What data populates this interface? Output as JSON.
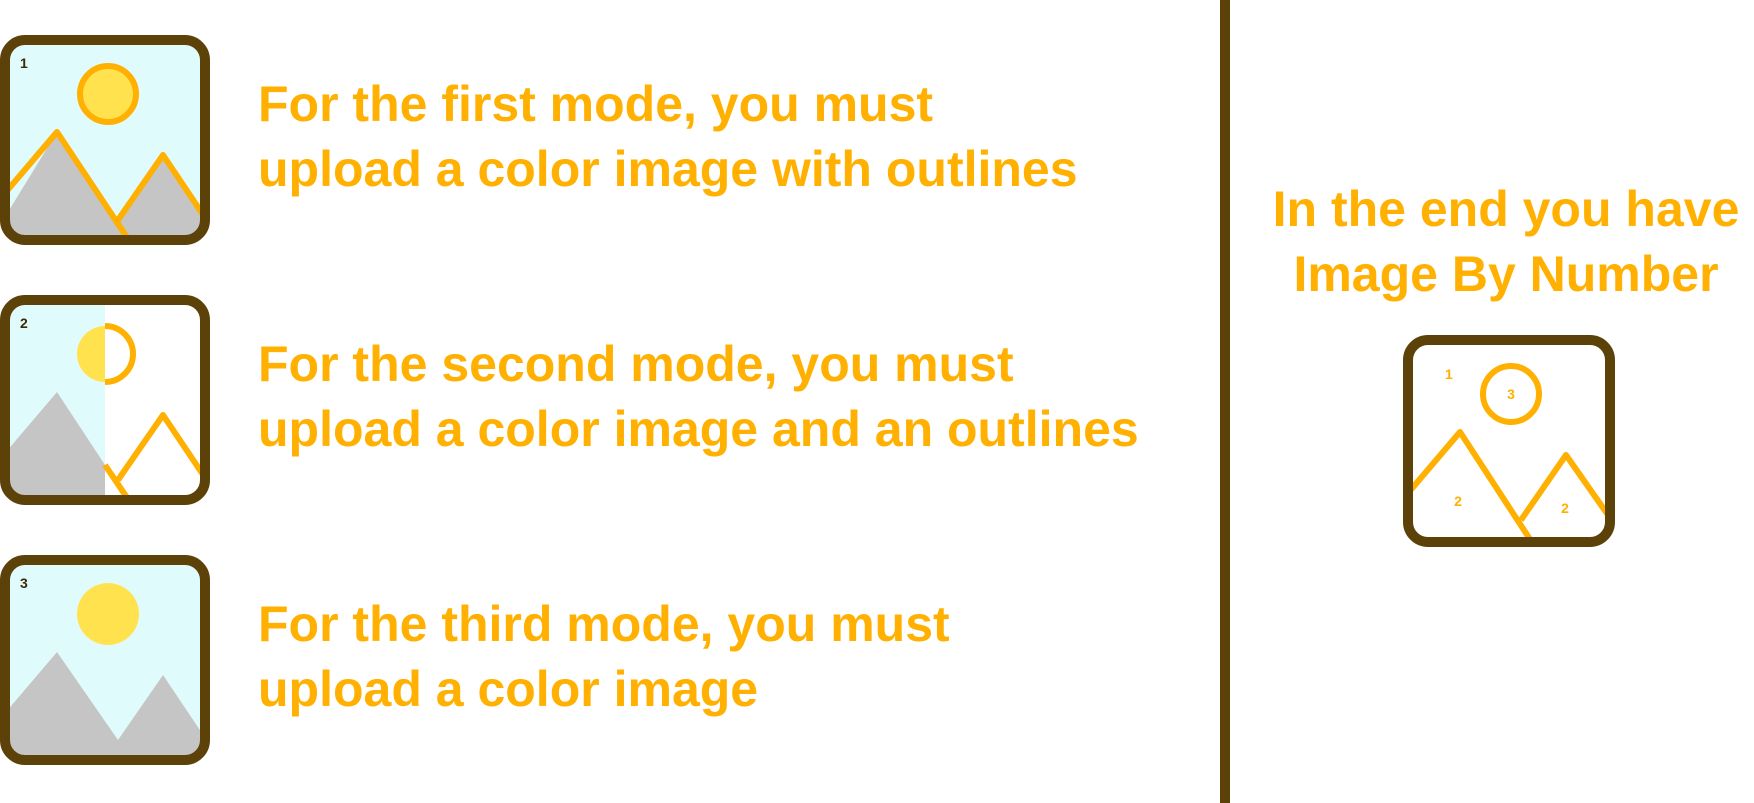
{
  "colors": {
    "frame": "#5c4209",
    "accent": "#ffb000",
    "sky": "#e0fbfc",
    "sun": "#ffe24d",
    "mountain": "#c5c5c5",
    "background": "#ffffff"
  },
  "modes": [
    {
      "number": "1",
      "line1": "For the first mode, you must",
      "line2": "upload a color image with outlines",
      "icon": "image-color-with-outlines-icon"
    },
    {
      "number": "2",
      "line1": "For the second mode, you must",
      "line2": "upload a color image and an outlines",
      "icon": "image-color-and-separate-outlines-icon"
    },
    {
      "number": "3",
      "line1": "For the third mode, you must",
      "line2": "upload a color image",
      "icon": "image-color-only-icon"
    }
  ],
  "result": {
    "line1": "In the end you have",
    "line2": "Image By Number",
    "icon": "image-by-number-icon",
    "region_numbers": {
      "top_left": "1",
      "sun": "3",
      "left_mountain": "2",
      "right_mountain": "2"
    }
  }
}
